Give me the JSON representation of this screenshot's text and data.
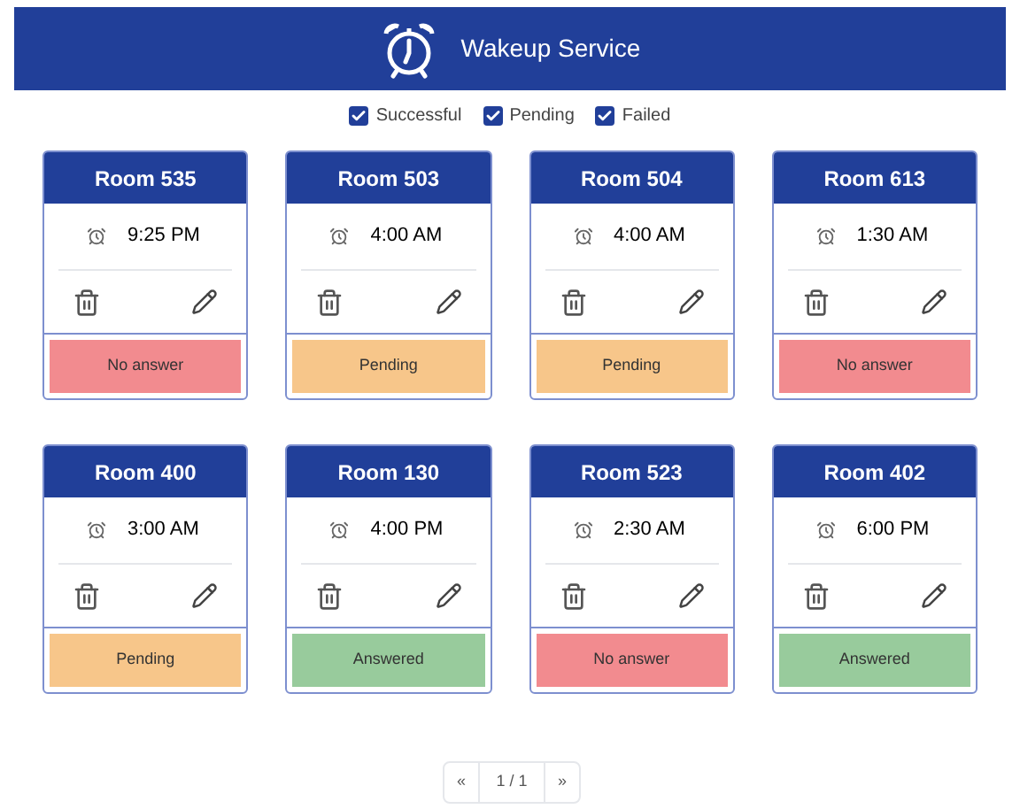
{
  "header": {
    "title": "Wakeup Service"
  },
  "filters": [
    {
      "label": "Successful",
      "checked": true
    },
    {
      "label": "Pending",
      "checked": true
    },
    {
      "label": "Failed",
      "checked": true
    }
  ],
  "cards": [
    {
      "room": "Room 535",
      "time": "9:25 PM",
      "status": "No answer",
      "kind": "failed"
    },
    {
      "room": "Room 503",
      "time": "4:00 AM",
      "status": "Pending",
      "kind": "pending"
    },
    {
      "room": "Room 504",
      "time": "4:00 AM",
      "status": "Pending",
      "kind": "pending"
    },
    {
      "room": "Room 613",
      "time": "1:30 AM",
      "status": "No answer",
      "kind": "failed"
    },
    {
      "room": "Room 400",
      "time": "3:00 AM",
      "status": "Pending",
      "kind": "pending"
    },
    {
      "room": "Room 130",
      "time": "4:00 PM",
      "status": "Answered",
      "kind": "answered"
    },
    {
      "room": "Room 523",
      "time": "2:30 AM",
      "status": "No answer",
      "kind": "failed"
    },
    {
      "room": "Room 402",
      "time": "6:00 PM",
      "status": "Answered",
      "kind": "answered"
    }
  ],
  "pagination": {
    "prev": "«",
    "page": "1 / 1",
    "next": "»"
  }
}
